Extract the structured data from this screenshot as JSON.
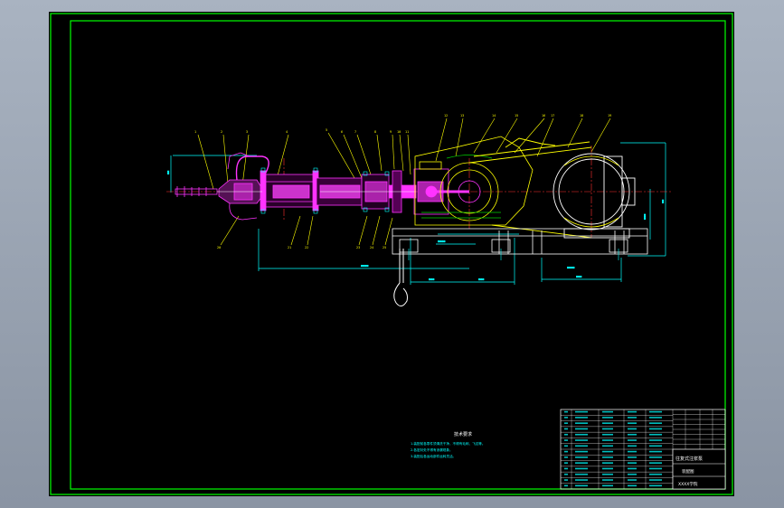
{
  "drawing": {
    "notes": {
      "title": "技术要求",
      "lines": [
        "1.装配前各零件须清洗干净，不得有毛刺、飞边等。",
        "2.各密封处不得有渗漏现象。",
        "3.装配后各运动部件运转灵活。"
      ]
    },
    "title_block": {
      "name": "往复式注浆泵",
      "sub": "装配图",
      "school": "XXXX学院"
    },
    "colors": {
      "border": "#00ff00",
      "frame": "#00ff00",
      "pink": "#ff33ff",
      "cyan": "#00ffff",
      "yellow": "#ffff00",
      "red": "#ff3030",
      "white": "#ffffff",
      "green": "#00d000"
    }
  }
}
